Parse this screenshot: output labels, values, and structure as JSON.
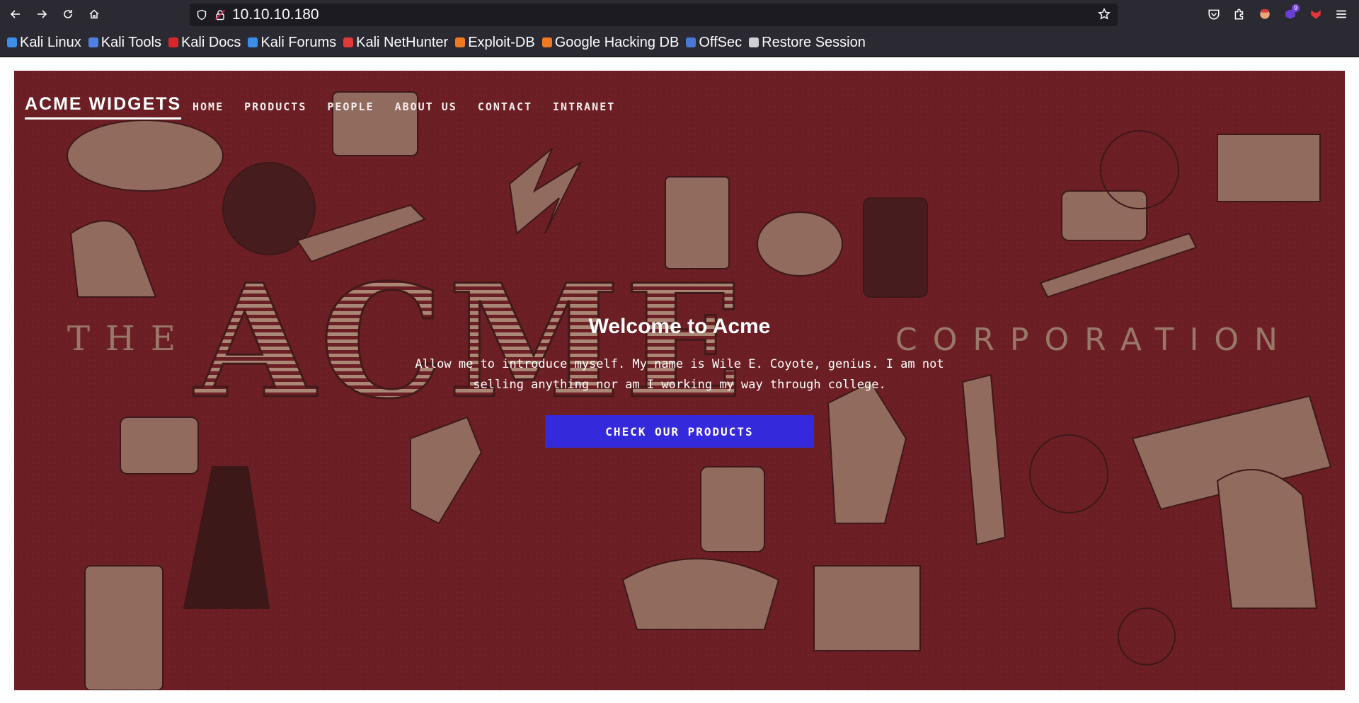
{
  "browser": {
    "url": "10.10.10.180",
    "extension_badge": "9",
    "bookmarks": [
      {
        "label": "Kali Linux",
        "color": "#3c8ee8"
      },
      {
        "label": "Kali Tools",
        "color": "#4f7fe0"
      },
      {
        "label": "Kali Docs",
        "color": "#d9262b"
      },
      {
        "label": "Kali Forums",
        "color": "#3c8ee8"
      },
      {
        "label": "Kali NetHunter",
        "color": "#e03a3a"
      },
      {
        "label": "Exploit-DB",
        "color": "#f07a22"
      },
      {
        "label": "Google Hacking DB",
        "color": "#f07a22"
      },
      {
        "label": "OffSec",
        "color": "#4a78d8"
      },
      {
        "label": "Restore Session",
        "color": "#cfcfd8"
      }
    ]
  },
  "site": {
    "brand": "ACME WIDGETS",
    "nav": [
      "HOME",
      "PRODUCTS",
      "PEOPLE",
      "ABOUT US",
      "CONTACT",
      "INTRANET"
    ],
    "hero": {
      "title": "Welcome to Acme",
      "text": "Allow me to introduce myself. My name is Wile E. Coyote, genius. I am not selling anything nor am I working my way through college.",
      "cta": "CHECK OUR PRODUCTS",
      "background_text": {
        "left": "THE",
        "center": "ACME",
        "right": "CORPORATION"
      }
    },
    "colors": {
      "hero_bg": "#6b1f24",
      "cta_bg": "#3529dc"
    }
  }
}
